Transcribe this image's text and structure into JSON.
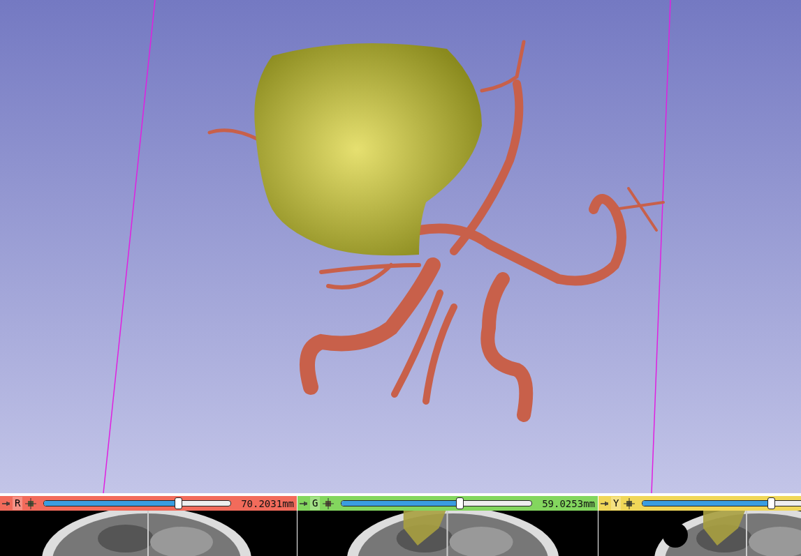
{
  "view_3d": {
    "kind": "render"
  },
  "slice_views": [
    {
      "letter": "R",
      "color": "#f26b5b",
      "level": 0.72,
      "offset": "70.2031mm"
    },
    {
      "letter": "G",
      "color": "#83d65e",
      "level": 0.62,
      "offset": "59.0253mm"
    },
    {
      "letter": "Y",
      "color": "#f0d758",
      "level": 0.7
    }
  ]
}
